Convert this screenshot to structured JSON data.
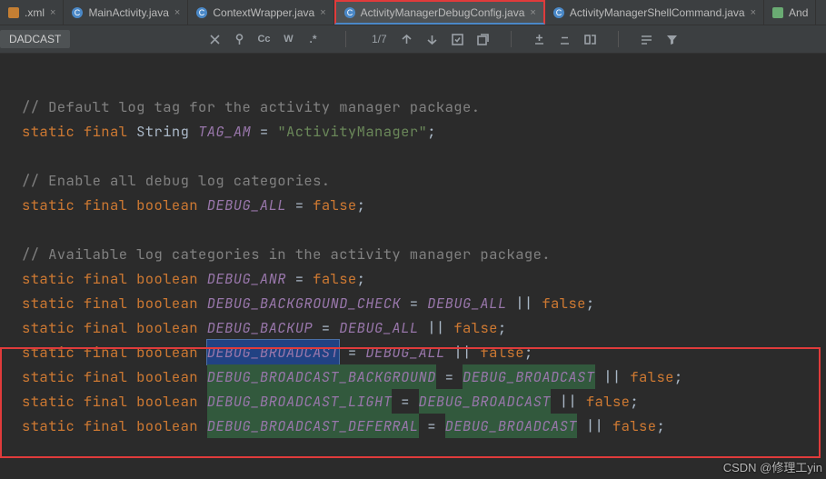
{
  "tabs": [
    {
      "label": ".xml",
      "kind": "xml",
      "active": false
    },
    {
      "label": "MainActivity.java",
      "kind": "java",
      "active": false
    },
    {
      "label": "ContextWrapper.java",
      "kind": "java",
      "active": false
    },
    {
      "label": "ActivityManagerDebugConfig.java",
      "kind": "java",
      "active": true,
      "boxed": true
    },
    {
      "label": "ActivityManagerShellCommand.java",
      "kind": "java",
      "active": false
    },
    {
      "label": "And",
      "kind": "res",
      "active": false,
      "overflow": true
    }
  ],
  "toolbar": {
    "chip": "DADCAST",
    "counter": "1/7",
    "icons_left": [
      "close",
      "pin",
      "case",
      "words",
      "regex"
    ],
    "icons_right": [
      "up",
      "down",
      "select-all",
      "open-new",
      "add-sel",
      "remove-sel",
      "toggle",
      "funnel",
      "filter"
    ]
  },
  "code": {
    "c1": "// Default log tag for the activity manager package.",
    "l1_kw": "static final ",
    "l1_type": "String ",
    "l1_id": "TAG_AM",
    "l1_eq": " = ",
    "l1_str": "\"ActivityManager\"",
    "l1_semi": ";",
    "c2": "// Enable all debug log categories.",
    "l2_kw": "static final boolean ",
    "l2_id": "DEBUG_ALL",
    "l2_eq": " = ",
    "l2_lit": "false",
    "l2_semi": ";",
    "c3": "// Available log categories in the activity manager package.",
    "l3_kw": "static final boolean ",
    "l3_id": "DEBUG_ANR",
    "l3_eq": " = ",
    "l3_lit": "false",
    "l3_semi": ";",
    "l4_kw": "static final boolean ",
    "l4_id": "DEBUG_BACKGROUND_CHECK",
    "l4_eq": " = ",
    "l4_ref": "DEBUG_ALL",
    "l4_op": " || ",
    "l4_lit": "false",
    "l4_semi": ";",
    "l5_kw": "static final boolean ",
    "l5_id": "DEBUG_BACKUP",
    "l5_eq": " = ",
    "l5_ref": "DEBUG_ALL",
    "l5_op": " || ",
    "l5_lit": "false",
    "l5_semi": ";",
    "l6_kw": "static final boolean ",
    "l6_id": "DEBUG_BROADCAST",
    "l6_eq": " = ",
    "l6_ref": "DEBUG_ALL",
    "l6_op": " || ",
    "l6_lit": "false",
    "l6_semi": ";",
    "l7_kw": "static final boolean ",
    "l7_id": "DEBUG_BROADCAST_BACKGROUND",
    "l7_eq": " = ",
    "l7_ref": "DEBUG_BROADCAST",
    "l7_op": " || ",
    "l7_lit": "false",
    "l7_semi": ";",
    "l8_kw": "static final boolean ",
    "l8_id": "DEBUG_BROADCAST_LIGHT",
    "l8_eq": " = ",
    "l8_ref": "DEBUG_BROADCAST",
    "l8_op": " || ",
    "l8_lit": "false",
    "l8_semi": ";",
    "l9_kw": "static final boolean ",
    "l9_id": "DEBUG_BROADCAST_DEFERRAL",
    "l9_eq": " = ",
    "l9_ref": "DEBUG_BROADCAST",
    "l9_op": " || ",
    "l9_lit": "false",
    "l9_semi": ";"
  },
  "watermark": "CSDN @修理工yin"
}
